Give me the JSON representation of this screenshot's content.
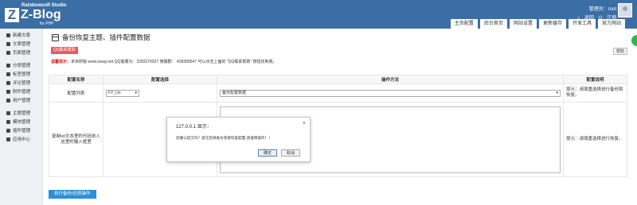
{
  "header": {
    "logo_mark": "Z",
    "brand": "Rainbowsoft Studio",
    "app_name": "Z-Blog",
    "app_sub": "for PHP",
    "manager_label": "管理员：",
    "username": "root",
    "home_link": "返回",
    "logout_link": "注销",
    "nav": [
      "主页配置",
      "后台首页",
      "网站设置",
      "更新缓存",
      "开发工具",
      "官方网站"
    ]
  },
  "sidebar": {
    "group1": [
      "新建文章",
      "文章管理",
      "页面管理"
    ],
    "group2": [
      "分类管理",
      "标签管理",
      "评论管理",
      "附件管理",
      "用户管理"
    ],
    "group3": [
      "主题管理",
      "模块管理",
      "插件管理",
      "应用中心"
    ]
  },
  "main": {
    "title": "备份恢复主题、插件配置数据",
    "qq_button": "QQ联系帮助",
    "help_button": "帮助",
    "notice_lead": "温馨提示：",
    "notice_text": "米米研版 www.tusay.net QQ客服为：2283276927 微服群： 428358547 可以点击上面的 \"QQ联系帮助\" 按钮找到我。",
    "table": {
      "headers": [
        "配置名称",
        "配置选择",
        "操作方法",
        "配置说明"
      ],
      "row1": {
        "name": "配置列表",
        "select_value": "FY_Uo",
        "method_value": "备份配置数据",
        "desc": "提示：请填重选择进行备份和恢复。"
      },
      "row2": {
        "name": "复制txt文本里的代码依入这里的输入框里",
        "desc": "提示：请填重选择进行恢复。"
      }
    },
    "execute_button": "执行备份/还原操作"
  },
  "dialog": {
    "title": "127.0.0.1 显示：",
    "close": "×",
    "message": "您确认提交吗？提交后将备份或者恢复配置,请谨慎操作！！",
    "ok": "确定",
    "cancel": "取消"
  }
}
